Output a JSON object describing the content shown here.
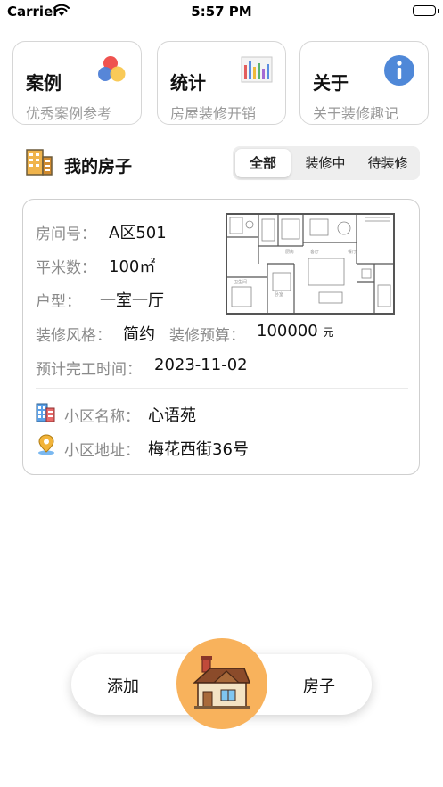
{
  "status_bar": {
    "carrier": "Carrier",
    "time": "5:57 PM"
  },
  "cards": [
    {
      "title": "案例",
      "subtitle": "优秀案例参考",
      "icon": "colored-circles-icon"
    },
    {
      "title": "统计",
      "subtitle": "房屋装修开销",
      "icon": "bar-chart-icon"
    },
    {
      "title": "关于",
      "subtitle": "关于装修趣记",
      "icon": "info-icon"
    }
  ],
  "section": {
    "title": "我的房子",
    "icon": "building-icon",
    "tabs": [
      {
        "label": "全部",
        "active": true
      },
      {
        "label": "装修中",
        "active": false
      },
      {
        "label": "待装修",
        "active": false
      }
    ]
  },
  "house": {
    "room_label": "房间号：",
    "room_value": "A区501",
    "area_label": "平米数：",
    "area_value": "100㎡",
    "type_label": "户型：",
    "type_value": "一室一厅",
    "style_label": "装修风格：",
    "style_value": "简约",
    "budget_label": "装修预算：",
    "budget_value": "100000",
    "budget_unit": "元",
    "finish_label": "预计完工时间：",
    "finish_value": "2023-11-02",
    "community_label": "小区名称：",
    "community_value": "心语苑",
    "address_label": "小区地址：",
    "address_value": "梅花西街36号"
  },
  "bottom_nav": {
    "left_label": "添加",
    "right_label": "房子",
    "center_icon": "house-icon"
  },
  "colors": {
    "accent_orange": "#f8b25c",
    "info_blue": "#4f88d8"
  }
}
